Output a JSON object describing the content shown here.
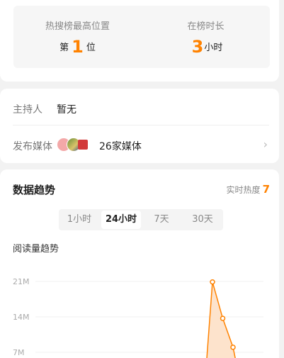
{
  "ranking": {
    "peak_label": "热搜榜最高位置",
    "peak_prefix": "第",
    "peak_value": "1",
    "peak_suffix": "位",
    "duration_label": "在榜时长",
    "duration_value": "3",
    "duration_unit": "小时"
  },
  "info": {
    "host_label": "主持人",
    "host_value": "暂无",
    "media_label": "发布媒体",
    "media_count": "26家媒体"
  },
  "trend": {
    "title": "数据趋势",
    "heat_label": "实时热度",
    "heat_value": "7",
    "tabs": [
      "1小时",
      "24小时",
      "7天",
      "30天"
    ],
    "active_tab": "24小时",
    "subtitle": "阅读量趋势"
  },
  "colors": {
    "accent": "#ff8200",
    "fill": "#fde3cc"
  },
  "chart_data": {
    "type": "area",
    "title": "阅读量趋势",
    "xlabel": "",
    "ylabel": "",
    "y_ticks": [
      "21M",
      "14M",
      "7M"
    ],
    "y_tick_values": [
      21,
      14,
      7
    ],
    "ylim": [
      0,
      21
    ],
    "grid": true,
    "series": [
      {
        "values": [
          null,
          20.9,
          13.7,
          8.0
        ]
      }
    ],
    "x": [
      0,
      1,
      2,
      3
    ]
  }
}
